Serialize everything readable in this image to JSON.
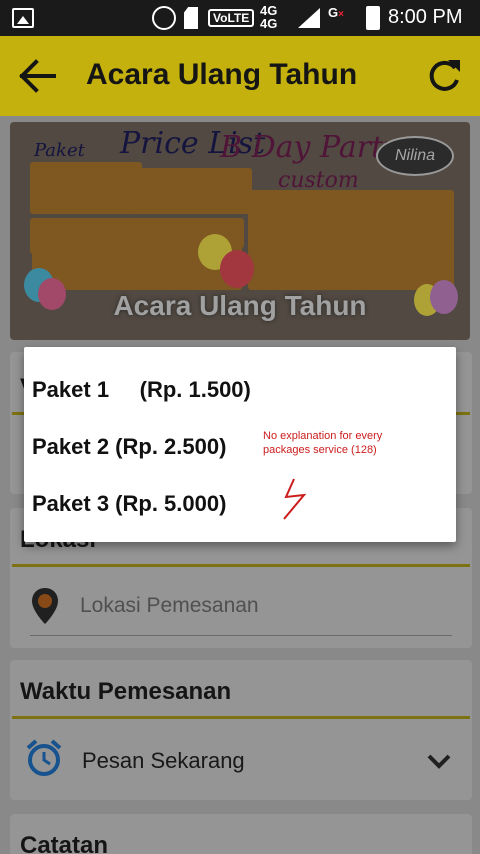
{
  "status_bar": {
    "time": "8:00 PM",
    "volte": "VoLTE",
    "net_top": "4G",
    "net_bottom": "4G",
    "g_label": "G",
    "g_mark": "×"
  },
  "app_bar": {
    "title": "Acara Ulang Tahun",
    "back_icon": "arrow-back-icon",
    "refresh_icon": "refresh-icon",
    "color": "#c4b10d"
  },
  "banner": {
    "caption": "Acara Ulang Tahun",
    "paket": "Paket",
    "price_list": "Price List",
    "bday": "B Day Party",
    "custom": "custom",
    "logo": "Nilina"
  },
  "form": {
    "location_section": "Lokasi",
    "location_placeholder": "Lokasi Pemesanan",
    "time_section": "Waktu Pemesanan",
    "time_value": "Pesan Sekarang",
    "notes_section": "Catatan",
    "partial_section_letter": "V"
  },
  "dialog": {
    "options": [
      "Paket 1     (Rp. 1.500)",
      "Paket 2 (Rp. 2.500)",
      "Paket 3 (Rp. 5.000)"
    ],
    "annotation": "No explanation for every packages service (128)"
  }
}
